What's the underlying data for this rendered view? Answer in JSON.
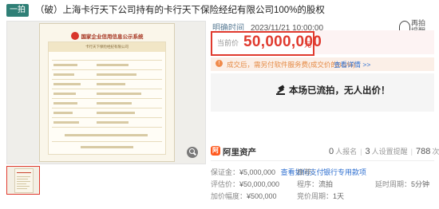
{
  "header": {
    "tag": "一拍",
    "title": "（破）上海卡行天下公司持有的卡行天下保险经纪有限公司100%的股权"
  },
  "image": {
    "doc_title": "国家企业信用信息公示系统",
    "doc_band": "卡行天下保险经纪有限公司"
  },
  "auction": {
    "start_label": "明确时间",
    "start_time": "2023/11/21 10:00:00",
    "remind_label": "再拍提醒",
    "price_label": "当前价",
    "price": "50,000,000",
    "price_unit": "元",
    "fee_text": "成交后，需另付软件服务费(成交价的0.5%)",
    "fee_link": "查看详情 >>",
    "result": "本场已流拍，无人出价！"
  },
  "platform": {
    "logo": "阿",
    "name": "阿里资产",
    "applicants": "0",
    "applicants_label": "人报名",
    "reminders": "3",
    "reminders_label": "人设置提醒",
    "views": "788",
    "views_label": "次围观"
  },
  "details": {
    "deposit_label": "保证金：",
    "deposit": "¥5,000,000",
    "deposit_link": "查看如何支付",
    "recommend_label": "推荐：",
    "recommend_link": "银行专用款项",
    "eval_label": "评估价：",
    "eval": "¥50,000,000",
    "proc_label": "程序：",
    "proc": "流拍",
    "delay_label": "延时周期：",
    "delay": "5分钟",
    "inc_label": "加价幅度：",
    "inc": "¥500,000",
    "cycle_label": "竞价周期：",
    "cycle": "1天"
  },
  "colors": {
    "accent": "#e03a2e",
    "tag": "#2f7f76",
    "link": "#2e6fd0",
    "fee": "#e58b46"
  }
}
